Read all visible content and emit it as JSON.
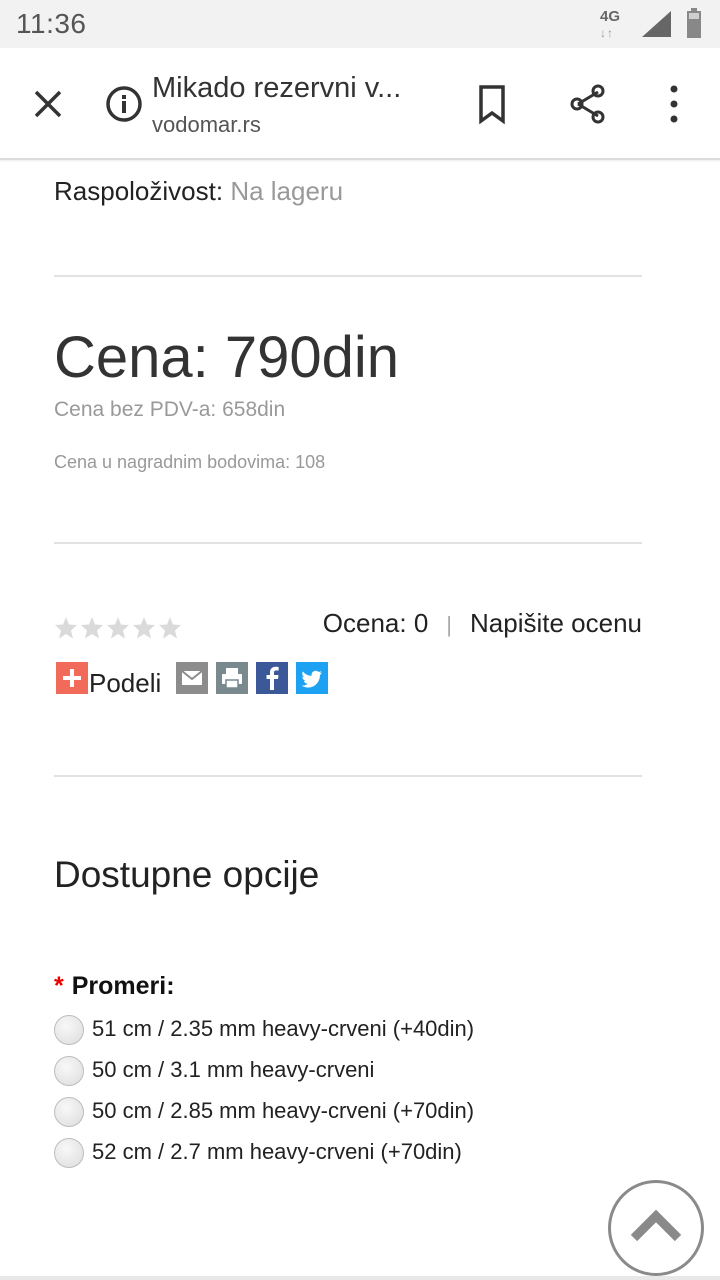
{
  "status_bar": {
    "time": "11:36",
    "network": "4G",
    "network_arrows": "↓↑",
    "icons": [
      "network-4g-icon",
      "signal-icon",
      "battery-icon"
    ]
  },
  "toolbar": {
    "title": "Mikado rezervni v...",
    "url": "vodomar.rs",
    "icons": [
      "close-icon",
      "info-icon",
      "bookmark-icon",
      "share-icon",
      "more-vert-icon"
    ]
  },
  "product": {
    "availability_label": "Raspoloživost:",
    "availability_value": "Na lageru",
    "price": "Cena: 790din",
    "price_net": "Cena bez PDV-a: 658din",
    "price_points": "Cena u nagradnim bodovima: 108"
  },
  "rating": {
    "stars_filled": 0,
    "stars_total": 5,
    "label": "Ocena: 0",
    "separator": "|",
    "write_review": "Napišite ocenu"
  },
  "share": {
    "label": "Podeli",
    "icons": [
      "share-plus-icon",
      "email-icon",
      "print-icon",
      "facebook-icon",
      "twitter-icon"
    ],
    "colors": {
      "plus": "#f16a5a",
      "email": "#8c8c8c",
      "print": "#79898d",
      "facebook": "#3b5998",
      "twitter": "#1da1f2"
    }
  },
  "options": {
    "title": "Dostupne opcije",
    "required_mark": "*",
    "group_label": "Promeri:",
    "items": [
      {
        "label": "51 cm / 2.35 mm heavy-crveni (+40din)"
      },
      {
        "label": "50 cm / 3.1 mm heavy-crveni"
      },
      {
        "label": "50 cm / 2.85 mm heavy-crveni (+70din)"
      },
      {
        "label": "52 cm / 2.7 mm heavy-crveni (+70din)"
      }
    ]
  },
  "scroll_top": {
    "icon": "chevron-up-icon"
  }
}
